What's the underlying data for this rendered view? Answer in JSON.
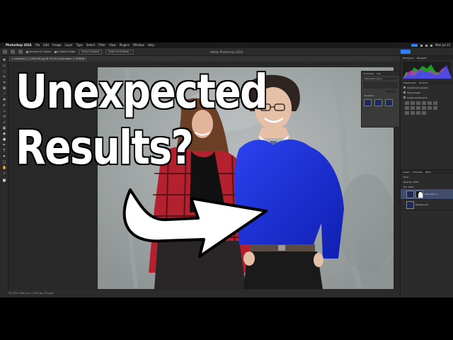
{
  "thumbnail": {
    "line1": "Unexpected",
    "line2": "Results?"
  },
  "menubar": {
    "app_name": "Photoshop 2024",
    "items": [
      "File",
      "Edit",
      "Image",
      "Layer",
      "Type",
      "Select",
      "Filter",
      "View",
      "Plugins",
      "Window",
      "Help"
    ],
    "clock": "Mon Jul 15"
  },
  "optionsbar": {
    "window_title": "Adobe Photoshop 2024",
    "opt1": "Sample All Layers",
    "opt2": "Enhance Edge",
    "opt3": "Select Subject",
    "opt4": "Select and Mask..."
  },
  "document": {
    "tab_title": "× selected_2_11426-96.jpg @ 33.3% (Saturation 1, RGB/8) *"
  },
  "statusbar": {
    "text": "33.33%   2560 px × 1920 px (72 ppi)"
  },
  "properties_panel": {
    "tab1": "Properties",
    "tab2": "Info",
    "row1": "Saturation Layer",
    "label": "Variations"
  },
  "right_panels": {
    "tab_histogram": "Histogram",
    "tab_navigator": "Navigator",
    "tab_adjustments": "Adjustments",
    "tab_libraries": "Libraries",
    "row_adjust_presets": "Adjustment presets",
    "row_view_presets": "View presets",
    "row_single_adjustments": "Single adjustments",
    "tab_layers": "Layers",
    "tab_channels": "Channels",
    "tab_paths": "Paths",
    "layer_kind": "Kind",
    "layer_opacity": "Opacity: 100%",
    "layer_fill": "Fill: 100%",
    "layer1": "Saturation 1",
    "layer2": "Background"
  },
  "colors": {
    "ps_bg": "#323232",
    "panel": "#2b2b2b",
    "accent": "#2d7ff9",
    "sweater": "#1a2fd6"
  }
}
